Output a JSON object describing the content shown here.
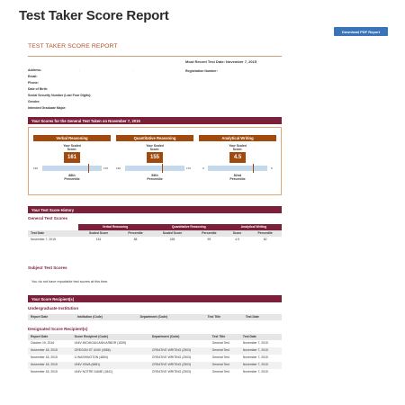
{
  "page": {
    "title": "Test Taker Score Report",
    "download_label": "Download PDF Report"
  },
  "report": {
    "heading": "TEST TAKER SCORE REPORT",
    "recent_label": "Most Recent Test Date: November 7, 2015",
    "registration_label": "Registration Number:",
    "info_labels": [
      "Address:",
      "Email:",
      "Phone:",
      "Date of Birth:",
      "Social Security Number (Last Four Digits):",
      "Gender:",
      "Intended Graduate Major:"
    ]
  },
  "general_scores": {
    "section_title": "Your Scores for the General Test Taken on November 7, 2015",
    "scaled_label_line1": "Your Scaled",
    "scaled_label_line2": "Score:",
    "sections": [
      {
        "name": "Verbal Reasoning",
        "score": "161",
        "min": "130",
        "max": "170",
        "percentile_line1": "88th",
        "percentile_line2": "Percentile",
        "fraction": 0.775
      },
      {
        "name": "Quantitative Reasoning",
        "score": "155",
        "min": "130",
        "max": "170",
        "percentile_line1": "59th",
        "percentile_line2": "Percentile",
        "fraction": 0.625
      },
      {
        "name": "Analytical Writing",
        "score": "4.5",
        "min": "0",
        "max": "6",
        "percentile_line1": "82nd",
        "percentile_line2": "Percentile",
        "fraction": 0.75
      }
    ]
  },
  "history": {
    "section_title": "Your Test Score History",
    "general_heading": "General Test Scores",
    "groups": [
      "Verbal Reasoning",
      "Quantitative Reasoning",
      "Analytical Writing"
    ],
    "columns": [
      "Test Date",
      "Scaled Score",
      "Percentile",
      "Scaled Score",
      "Percentile",
      "Score",
      "Percentile"
    ],
    "rows": [
      [
        "November 7, 2015",
        "161",
        "88",
        "155",
        "59",
        "4.5",
        "82"
      ]
    ],
    "subject_heading": "Subject Test Scores",
    "no_subject_text": "You do not have reportable test scores at this time."
  },
  "recipients": {
    "section_title": "Your Score Recipient(s)",
    "undergrad_heading": "Undergraduate Institution",
    "undergrad_columns": [
      "Report Date",
      "Institution (Code)",
      "Department (Code)",
      "Test Title",
      "Test Date"
    ],
    "designated_heading": "Designated Score Recipient(s)",
    "designated_columns": [
      "Report Date",
      "Score Recipient (Code)",
      "Department (Code)",
      "Test Title",
      "Test Date"
    ],
    "rows": [
      [
        "October 19, 2016",
        "UNIV MICHIGAN ANN ARBOR (1839)",
        "",
        "General Test",
        "November 7, 2015"
      ],
      [
        "November 18, 2015",
        "OREGON ST UNIV (4586)",
        "CREATIVE WRITING (2503)",
        "General Test",
        "November 7, 2015"
      ],
      [
        "November 18, 2015",
        "U WASHINGTON (4854)",
        "CREATIVE WRITING (2503)",
        "General Test",
        "November 7, 2015"
      ],
      [
        "November 18, 2015",
        "UNIV IOWA (6681)",
        "CREATIVE WRITING (2503)",
        "General Test",
        "November 7, 2015"
      ],
      [
        "November 18, 2015",
        "UNIV NOTRE DAME (1841)",
        "CREATIVE WRITING (2503)",
        "General Test",
        "November 7, 2015"
      ]
    ]
  }
}
